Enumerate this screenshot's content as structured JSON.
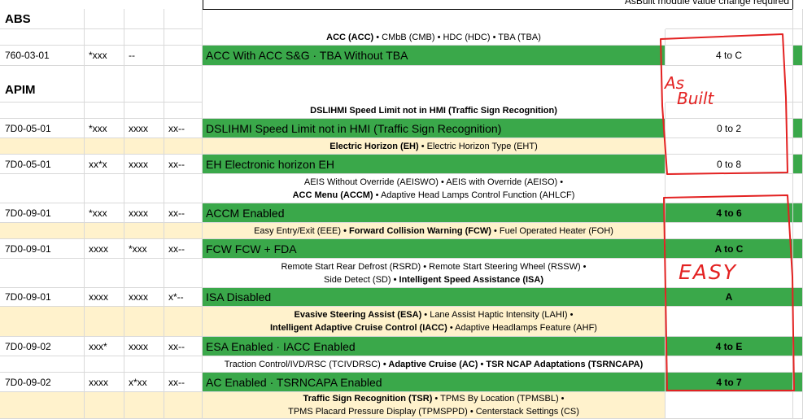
{
  "header_note": "AsBuilt module value change required",
  "sections": {
    "abs": "ABS",
    "apim": "APIM"
  },
  "rows": {
    "acc_desc": {
      "b1": "ACC (ACC)",
      "t1": " • CMbB (CMB) • HDC (HDC) • TBA (TBA)"
    },
    "r760": {
      "addr": "760-03-01",
      "m1": "*xxx",
      "m2": "--",
      "m3": "",
      "feature": "ACC With ACC S&G · TBA Without TBA",
      "value": "4 to C"
    },
    "dsl_desc": {
      "b1": "DSLIHMI Speed Limit not in HMI (Traffic Sign Recognition)"
    },
    "r7d0_05a": {
      "addr": "7D0-05-01",
      "m1": "*xxx",
      "m2": "xxxx",
      "m3": "xx--",
      "feature": "DSLIHMI Speed Limit not in HMI (Traffic Sign Recognition)",
      "value": "0 to 2"
    },
    "eh_desc": {
      "b1": "Electric Horizon (EH)",
      "t1": " • Electric Horizon Type (EHT)"
    },
    "r7d0_05b": {
      "addr": "7D0-05-01",
      "m1": "xx*x",
      "m2": "xxxx",
      "m3": "xx--",
      "feature": "EH Electronic horizon EH",
      "value": "0 to 8"
    },
    "aeis_desc": {
      "l1": "AEIS Without Override (AEISWO) • AEIS with Override (AEISO) •",
      "b2": "ACC Menu (ACCM)",
      "t2": " • Adaptive Head Lamps Control Function (AHLCF)"
    },
    "r7d0_09a": {
      "addr": "7D0-09-01",
      "m1": "*xxx",
      "m2": "xxxx",
      "m3": "xx--",
      "feature": "ACCM Enabled",
      "value": "4 to 6"
    },
    "eee_desc": {
      "t1": "Easy Entry/Exit (EEE) ",
      "b1": "• Forward Collision Warning (FCW)",
      "t2": " • Fuel Operated Heater  (FOH)"
    },
    "r7d0_09b": {
      "addr": "7D0-09-01",
      "m1": "xxxx",
      "m2": "*xxx",
      "m3": "xx--",
      "feature": "FCW FCW + FDA",
      "value": "A to C"
    },
    "rsrd_desc": {
      "l1": "Remote Start Rear Defrost (RSRD) • Remote Start Steering Wheel (RSSW) •",
      "t2": "Side Detect (SD) ",
      "b2": "• Intelligent Speed Assistance (ISA)"
    },
    "r7d0_09c": {
      "addr": "7D0-09-01",
      "m1": "xxxx",
      "m2": "xxxx",
      "m3": "x*--",
      "feature": "ISA Disabled",
      "value": "A"
    },
    "esa_desc": {
      "b1": "Evasive Steering Assist (ESA)",
      "t1": " • Lane Assist Haptic Intensity (LAHI) •",
      "b2": "Intelligent Adaptive Cruise Control (IACC)",
      "t2": " • Adaptive Headlamps Feature (AHF)"
    },
    "r7d0_09d": {
      "addr": "7D0-09-02",
      "m1": "xxx*",
      "m2": "xxxx",
      "m3": "xx--",
      "feature": "ESA Enabled · IACC Enabled",
      "value": "4 to E"
    },
    "tc_desc": {
      "t1": "Traction Control/IVD/RSC  (TCIVDRSC) ",
      "b1": "• Adaptive Cruise (AC) • TSR NCAP Adaptations (TSRNCAPA)"
    },
    "r7d0_09e": {
      "addr": "7D0-09-02",
      "m1": "xxxx",
      "m2": "x*xx",
      "m3": "xx--",
      "feature": "AC Enabled · TSRNCAPA Enabled",
      "value": "4 to 7"
    },
    "tsr_desc": {
      "b1": "Traffic Sign Recognition (TSR)",
      "t1": " • TPMS By Location (TPMSBL) •",
      "l2": "TPMS Placard Pressure Display (TPMSPPD) • Centerstack Settings (CS)"
    }
  },
  "annotations": {
    "asbuilt_1": "As",
    "asbuilt_2": "Built",
    "easy": "EASY"
  },
  "colors": {
    "green": "#3aa84a",
    "cream": "#fff2cc",
    "ink_red": "#e32222",
    "grid": "#d9d9d9"
  }
}
